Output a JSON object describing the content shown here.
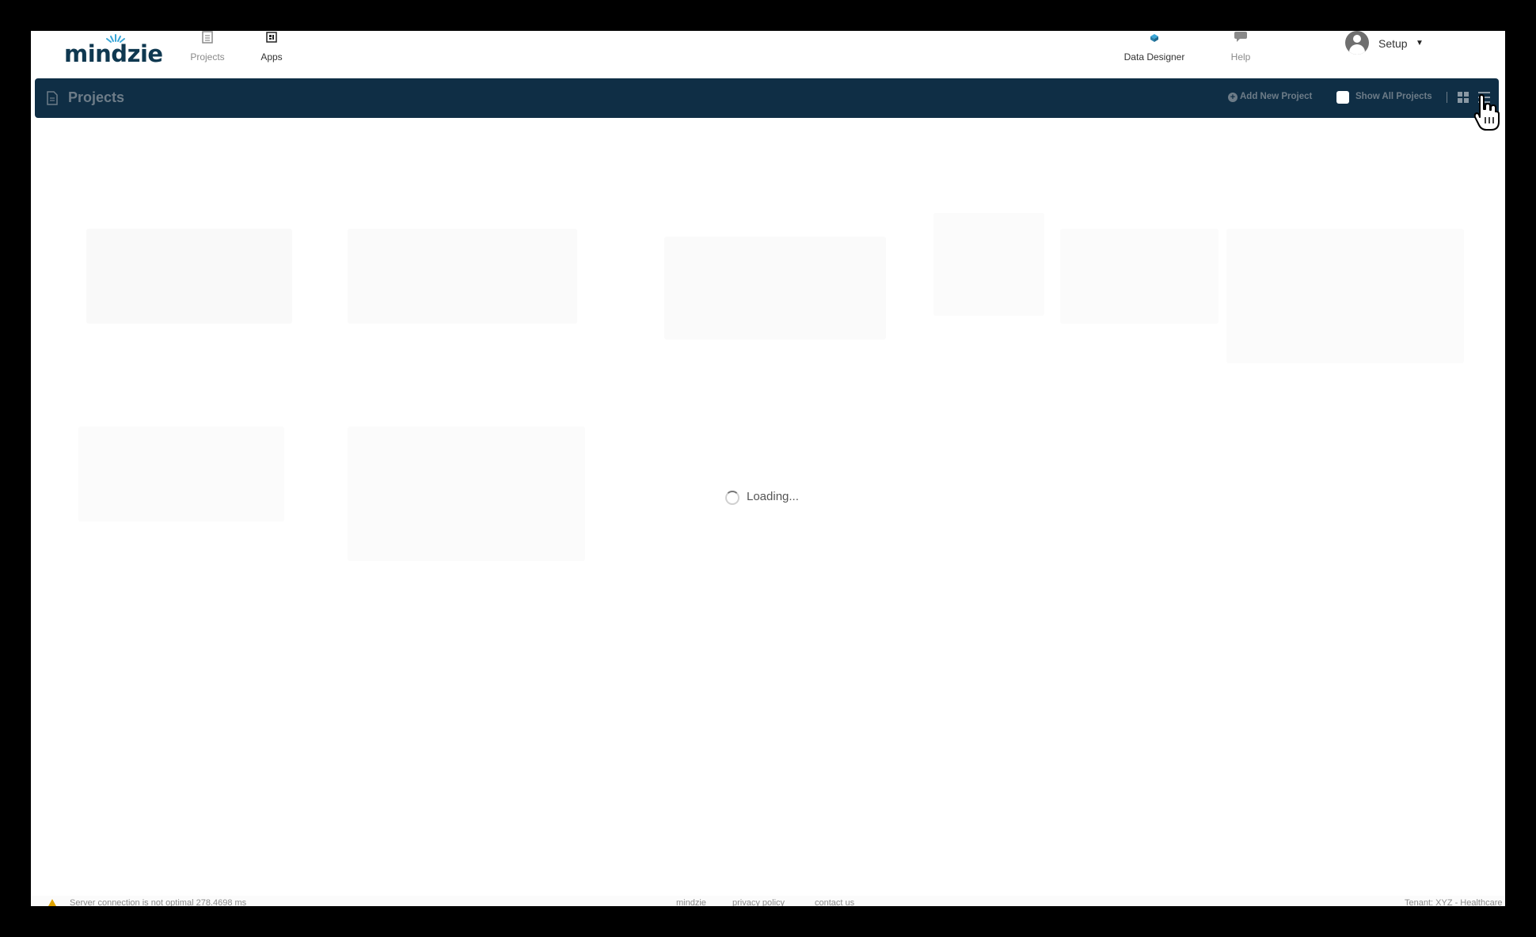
{
  "brand": {
    "name": "mindzie"
  },
  "topnav": {
    "items": [
      {
        "label": "Projects",
        "icon": "document-icon"
      },
      {
        "label": "Apps",
        "icon": "apps-icon"
      }
    ],
    "right_items": [
      {
        "label": "Data Designer",
        "icon": "cube-icon"
      },
      {
        "label": "Help",
        "icon": "chat-bubble-icon"
      }
    ],
    "user": {
      "label": "Setup",
      "icon": "user-avatar-icon"
    }
  },
  "projects_bar": {
    "title": "Projects",
    "add_label": "Add New Project",
    "show_all_label": "Show All Projects",
    "show_all_checked": false
  },
  "loading": {
    "label": "Loading..."
  },
  "footer": {
    "status": "Server connection is not optimal 278.4698 ms",
    "links": [
      "mindzie",
      "privacy policy",
      "contact us"
    ],
    "tenant": "Tenant: XYZ - Healthcare"
  },
  "colors": {
    "header_bar": "#0f2e45",
    "brand": "#0f3850",
    "accent": "#3ba7d8",
    "warning": "#e0a400"
  }
}
